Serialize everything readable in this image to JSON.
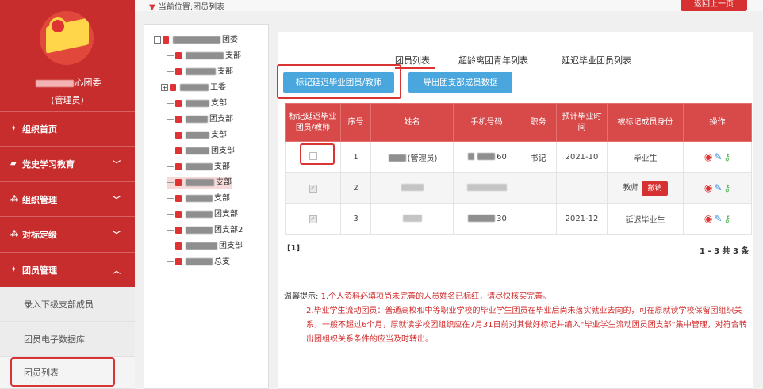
{
  "sidebar": {
    "org_suffix": "心团委",
    "role": "(管理员)",
    "nav": [
      {
        "icon": "home-icon",
        "label": "组织首页",
        "glyph": "✦"
      },
      {
        "icon": "folder-icon",
        "label": "党史学习教育",
        "glyph": "▰"
      },
      {
        "icon": "org-icon",
        "label": "组织管理",
        "glyph": "⁂"
      },
      {
        "icon": "target-icon",
        "label": "对标定级",
        "glyph": "⁂"
      },
      {
        "icon": "members-icon",
        "label": "团员管理",
        "glyph": "✦"
      }
    ],
    "sub_items": [
      "录入下级支部成员",
      "团员电子数据库",
      "团员列表"
    ]
  },
  "header": {
    "breadcrumb": "当前位置:团员列表",
    "back_label": "返回上一页"
  },
  "tree": {
    "nodes": [
      "团委",
      "支部",
      "支部",
      "工委",
      "支部",
      "团支部",
      "支部",
      "团支部",
      "支部",
      "支部",
      "支部",
      "团支部",
      "团支部2",
      "团支部",
      "总支"
    ]
  },
  "tabs": [
    "团员列表",
    "超龄离团青年列表",
    "延迟毕业团员列表"
  ],
  "buttons": {
    "mark_label": "标记延迟毕业团员/教师",
    "export_label": "导出团支部成员数据"
  },
  "table": {
    "headers": [
      "标记延迟毕业团员/教师",
      "序号",
      "姓名",
      "手机号码",
      "职务",
      "预计毕业时间",
      "被标记成员身份",
      "操作"
    ],
    "rows": [
      {
        "seq": "1",
        "name": "(管理员)",
        "phone": "60",
        "duty": "书记",
        "grad": "2021-10",
        "identity": "毕业生",
        "checked": false
      },
      {
        "seq": "2",
        "name": "",
        "phone": "",
        "duty": "",
        "grad": "",
        "identity": "教师",
        "revoke": "撤销",
        "checked": true
      },
      {
        "seq": "3",
        "name": "",
        "phone": "30",
        "duty": "",
        "grad": "2021-12",
        "identity": "延迟毕业生",
        "checked": true
      }
    ]
  },
  "pager": {
    "pages": "[1]",
    "count": "1 - 3  共 3 条"
  },
  "tips": {
    "label": "温馨提示:",
    "line1": "1.个人资料必填项尚未完善的人员姓名已标红，请尽快核实完善。",
    "line2": "2.毕业学生流动团员：普通高校和中等职业学校的毕业学生团员在毕业后尚未落实就业去向的，可在原就读学校保留团组织关系，一般不超过6个月，原就读学校团组织应在7月31日前对其做好标记并编入“毕业学生流动团员团支部”集中管理，对符合转出团组织关系条件的应当及时转出。"
  },
  "colors": {
    "primary_red": "#c82d2d",
    "button_blue": "#4aa7de",
    "header_red": "#d84a4a"
  }
}
